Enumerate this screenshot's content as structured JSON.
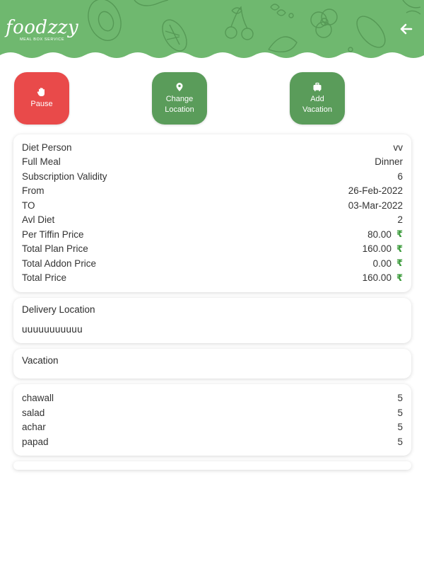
{
  "header": {
    "brand": "foodzzy",
    "tagline": "MEAL BOX SERVICE",
    "back_icon": "arrow-left-icon",
    "bg_color": "#6fb86f"
  },
  "actions": [
    {
      "label_line1": "Pause",
      "label_line2": "",
      "icon": "hand-icon",
      "color": "#e94a4a"
    },
    {
      "label_line1": "Change",
      "label_line2": "Location",
      "icon": "location-pin-icon",
      "color": "#5a9c5a"
    },
    {
      "label_line1": "Add",
      "label_line2": "Vacation",
      "icon": "suitcase-icon",
      "color": "#5a9c5a"
    }
  ],
  "details": [
    {
      "label": "Diet Person",
      "value": "vv",
      "currency": ""
    },
    {
      "label": "Full Meal",
      "value": "Dinner",
      "currency": ""
    },
    {
      "label": "Subscription Validity",
      "value": "6",
      "currency": ""
    },
    {
      "label": "From",
      "value": "26-Feb-2022",
      "currency": ""
    },
    {
      "label": "TO",
      "value": "03-Mar-2022",
      "currency": ""
    },
    {
      "label": "Avl Diet",
      "value": "2",
      "currency": ""
    },
    {
      "label": "Per Tiffin Price",
      "value": "80.00",
      "currency": "₹"
    },
    {
      "label": "Total Plan Price",
      "value": "160.00",
      "currency": "₹"
    },
    {
      "label": "Total Addon Price",
      "value": "0.00",
      "currency": "₹"
    },
    {
      "label": "Total Price",
      "value": "160.00",
      "currency": "₹"
    }
  ],
  "delivery": {
    "title": "Delivery Location",
    "address": "uuuuuuuuuuu"
  },
  "vacation": {
    "title": "Vacation"
  },
  "items": [
    {
      "name": "chawall",
      "qty": "5"
    },
    {
      "name": "salad",
      "qty": "5"
    },
    {
      "name": "achar",
      "qty": "5"
    },
    {
      "name": "papad",
      "qty": "5"
    }
  ]
}
